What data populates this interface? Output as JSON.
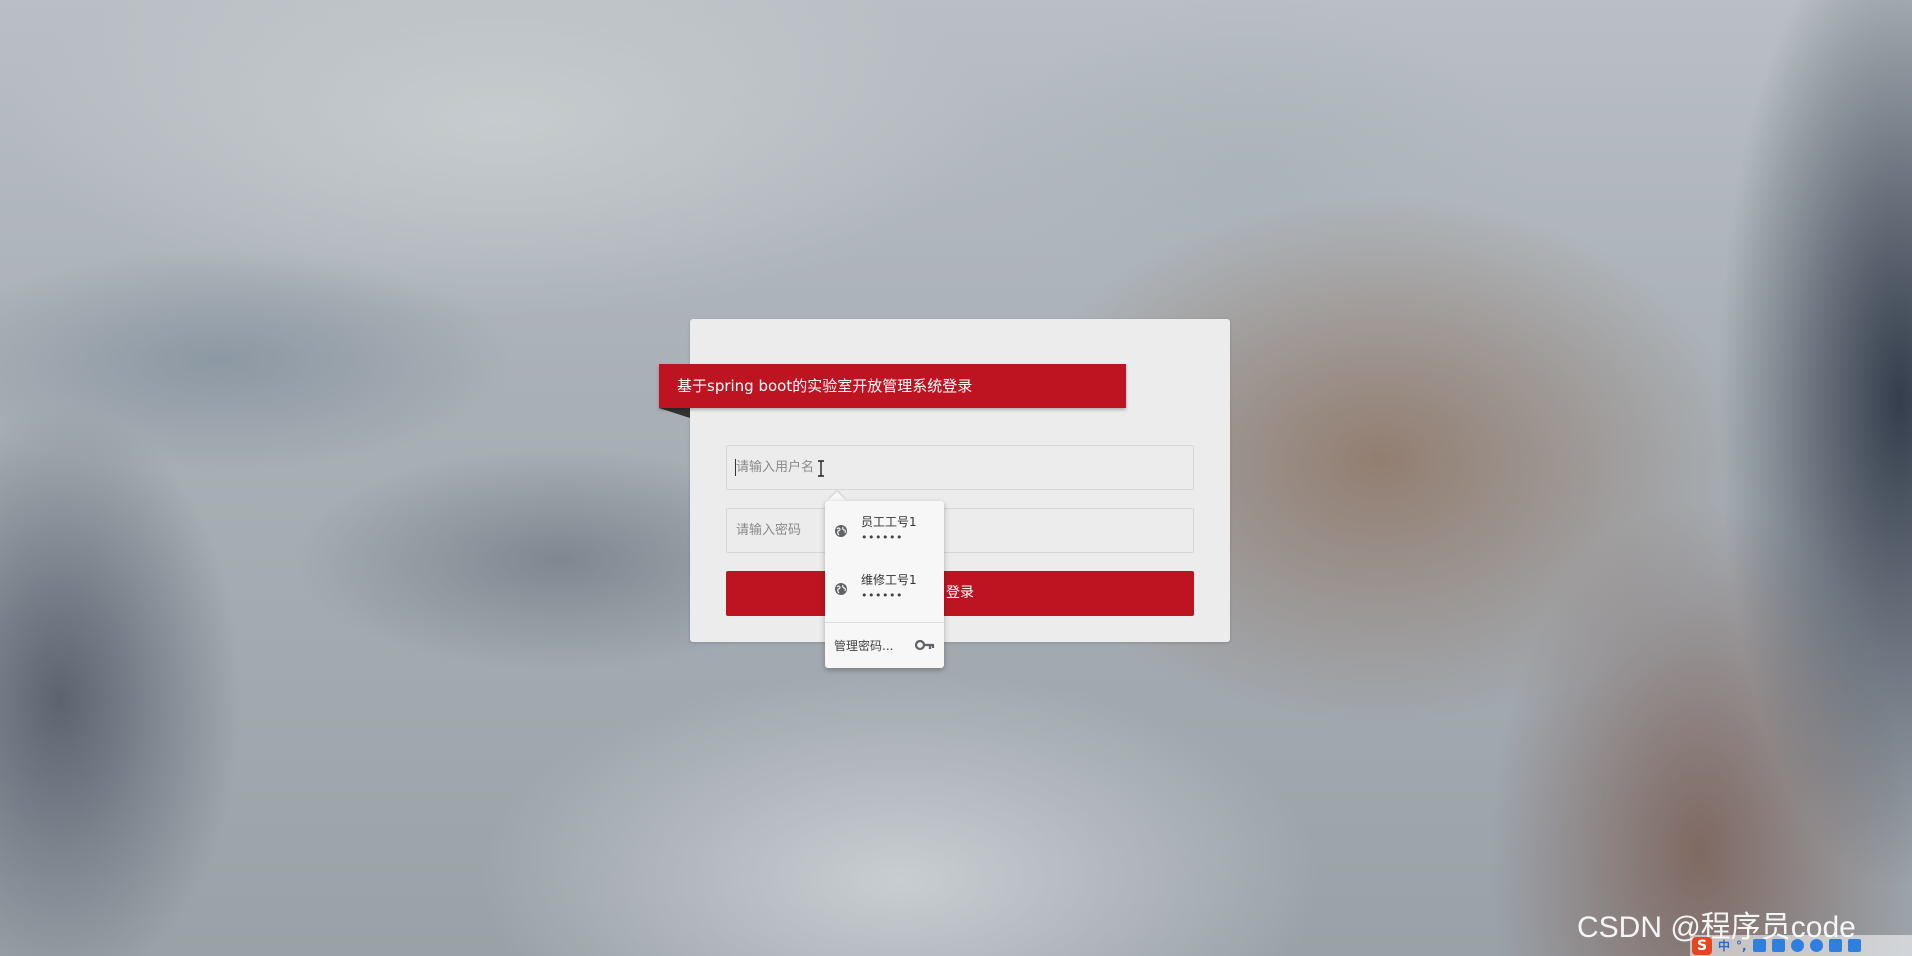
{
  "login": {
    "title": "基于spring boot的实验室开放管理系统登录",
    "username_placeholder": "请输入用户名",
    "password_placeholder": "请输入密码",
    "login_button": "登录"
  },
  "autofill": {
    "credentials": [
      {
        "name": "员工工号1",
        "password_mask": "••••••",
        "icon": "globe-icon"
      },
      {
        "name": "维修工号1",
        "password_mask": "••••••",
        "icon": "globe-icon"
      }
    ],
    "manage_label": "管理密码...",
    "manage_icon": "key-icon"
  },
  "watermark": "CSDN @程序员code",
  "ime": {
    "logo": "S",
    "mode": "中",
    "punct": "°,",
    "icons": [
      "mic-icon",
      "keyboard-icon",
      "shirt-icon",
      "gamepad-icon",
      "grid-icon",
      "tool-icon"
    ]
  },
  "colors": {
    "accent": "#be1421",
    "card": "#ececec",
    "ribbon_fold": "#333333"
  }
}
